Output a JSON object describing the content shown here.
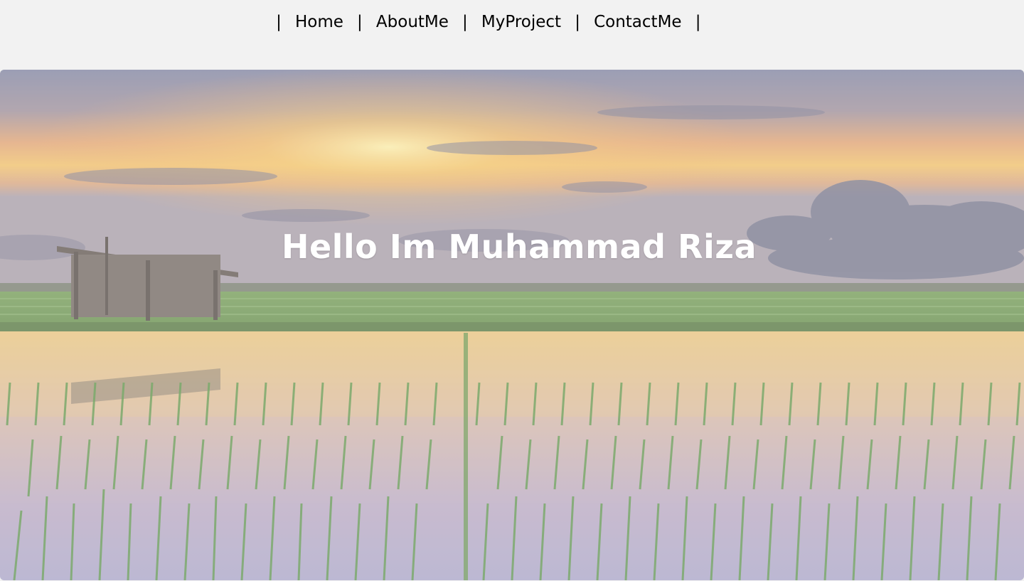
{
  "nav": {
    "separator": "|",
    "items": [
      {
        "label": "Home"
      },
      {
        "label": "AboutMe"
      },
      {
        "label": "MyProject"
      },
      {
        "label": "ContactMe"
      }
    ]
  },
  "hero": {
    "title": "Hello Im Muhammad Riza",
    "image_description_icon": "rice-field-sunset-image"
  }
}
